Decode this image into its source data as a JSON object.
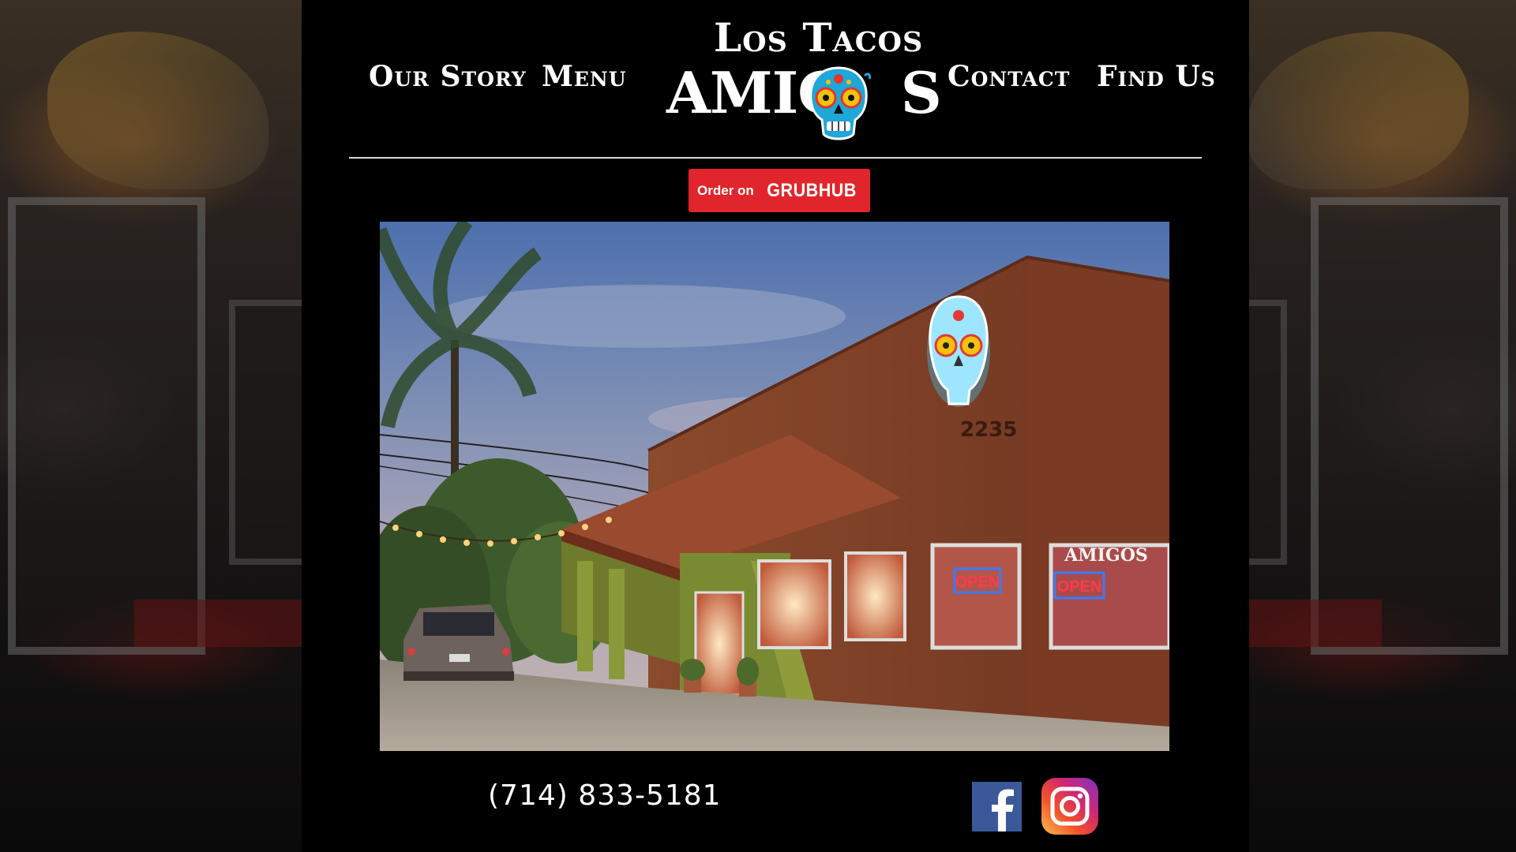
{
  "nav": {
    "items": [
      {
        "label": "Our Story"
      },
      {
        "label": "Menu"
      },
      {
        "label": "Contact"
      },
      {
        "label": "Find Us"
      }
    ]
  },
  "logo": {
    "line1": "Los Tacos",
    "line2": "AMIG",
    "line2_end": "S"
  },
  "order_button": {
    "prefix": "Order on",
    "brand": "GRUBHUB"
  },
  "storefront": {
    "address_number": "2235",
    "sign_open": "OPEN",
    "window_text": "AMIGOS"
  },
  "footer": {
    "phone": "(714) 833-5181"
  },
  "social": {
    "facebook_icon": "facebook-icon",
    "instagram_icon": "instagram-icon"
  },
  "colors": {
    "panel_bg": "#000000",
    "grubhub_red": "#e0262c",
    "facebook_blue": "#3b5998",
    "text": "#ffffff"
  }
}
